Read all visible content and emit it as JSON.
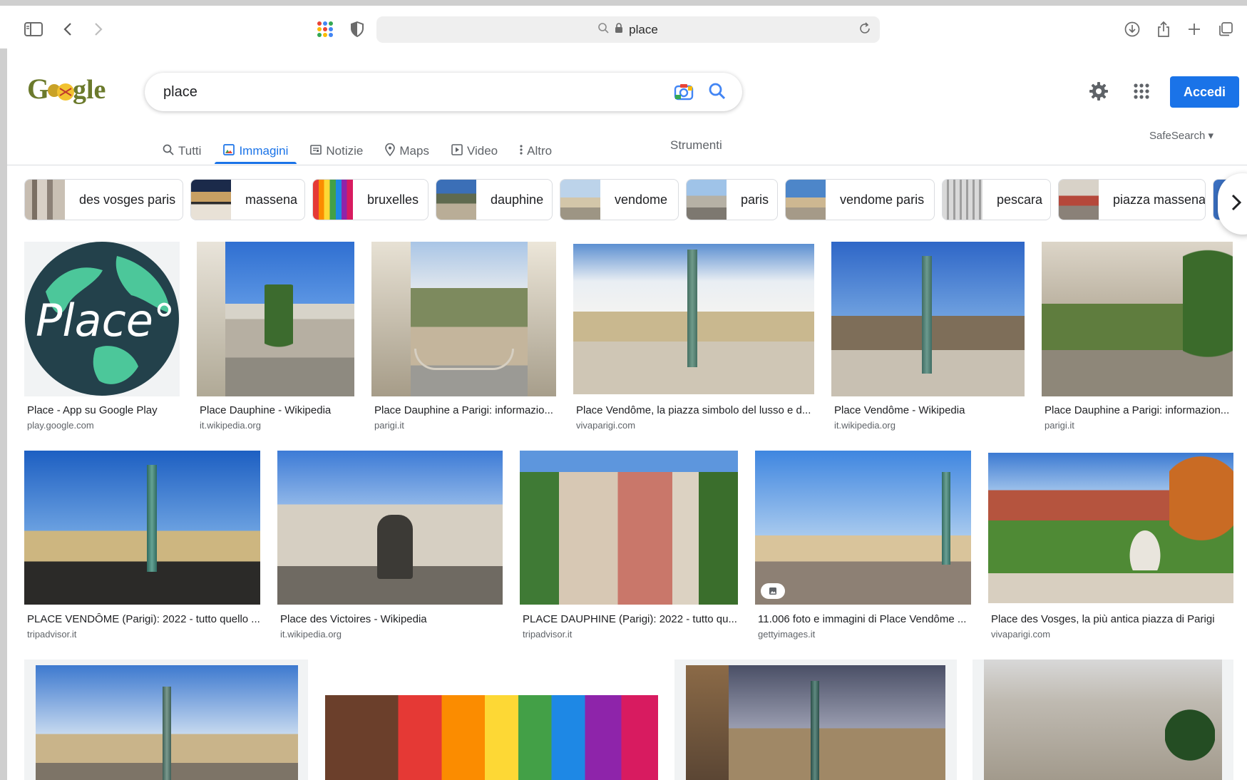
{
  "browser": {
    "address_text": "place",
    "icons": [
      "sidebar-icon",
      "back-icon",
      "forward-icon",
      "apps-grid-icon",
      "privacy-shield-icon",
      "search-icon",
      "lock-icon",
      "reload-icon",
      "download-icon",
      "share-icon",
      "new-tab-icon",
      "tab-overview-icon"
    ]
  },
  "google": {
    "query": "place",
    "signin_label": "Accedi",
    "tools_label": "Strumenti",
    "safesearch_label": "SafeSearch ▾",
    "tabs": [
      {
        "label": "Tutti",
        "icon": "search-icon"
      },
      {
        "label": "Immagini",
        "icon": "image-icon",
        "active": true
      },
      {
        "label": "Notizie",
        "icon": "news-icon"
      },
      {
        "label": "Maps",
        "icon": "pin-icon"
      },
      {
        "label": "Video",
        "icon": "play-icon"
      },
      {
        "label": "Altro",
        "icon": "more-icon"
      }
    ],
    "chips": [
      "des vosges paris",
      "massena",
      "bruxelles",
      "dauphine",
      "vendome",
      "paris",
      "vendome paris",
      "pescara",
      "piazza massena"
    ],
    "results": [
      {
        "title": "Place - App su Google Play",
        "source": "play.google.com"
      },
      {
        "title": "Place Dauphine - Wikipedia",
        "source": "it.wikipedia.org"
      },
      {
        "title": "Place Dauphine a Parigi: informazio...",
        "source": "parigi.it"
      },
      {
        "title": "Place Vendôme, la piazza simbolo del lusso e d...",
        "source": "vivaparigi.com"
      },
      {
        "title": "Place Vendôme - Wikipedia",
        "source": "it.wikipedia.org"
      },
      {
        "title": "Place Dauphine a Parigi: informazion...",
        "source": "parigi.it"
      },
      {
        "title": "PLACE VENDÔME (Parigi): 2022 - tutto quello ...",
        "source": "tripadvisor.it"
      },
      {
        "title": "Place des Victoires - Wikipedia",
        "source": "it.wikipedia.org"
      },
      {
        "title": "PLACE DAUPHINE (Parigi): 2022 - tutto qu...",
        "source": "tripadvisor.it"
      },
      {
        "title": "11.006 foto e immagini di Place Vendôme ...",
        "source": "gettyimages.it"
      },
      {
        "title": "Place des Vosges, la più antica piazza di Parigi",
        "source": "vivaparigi.com"
      }
    ],
    "app_logo_text": "Place°"
  }
}
